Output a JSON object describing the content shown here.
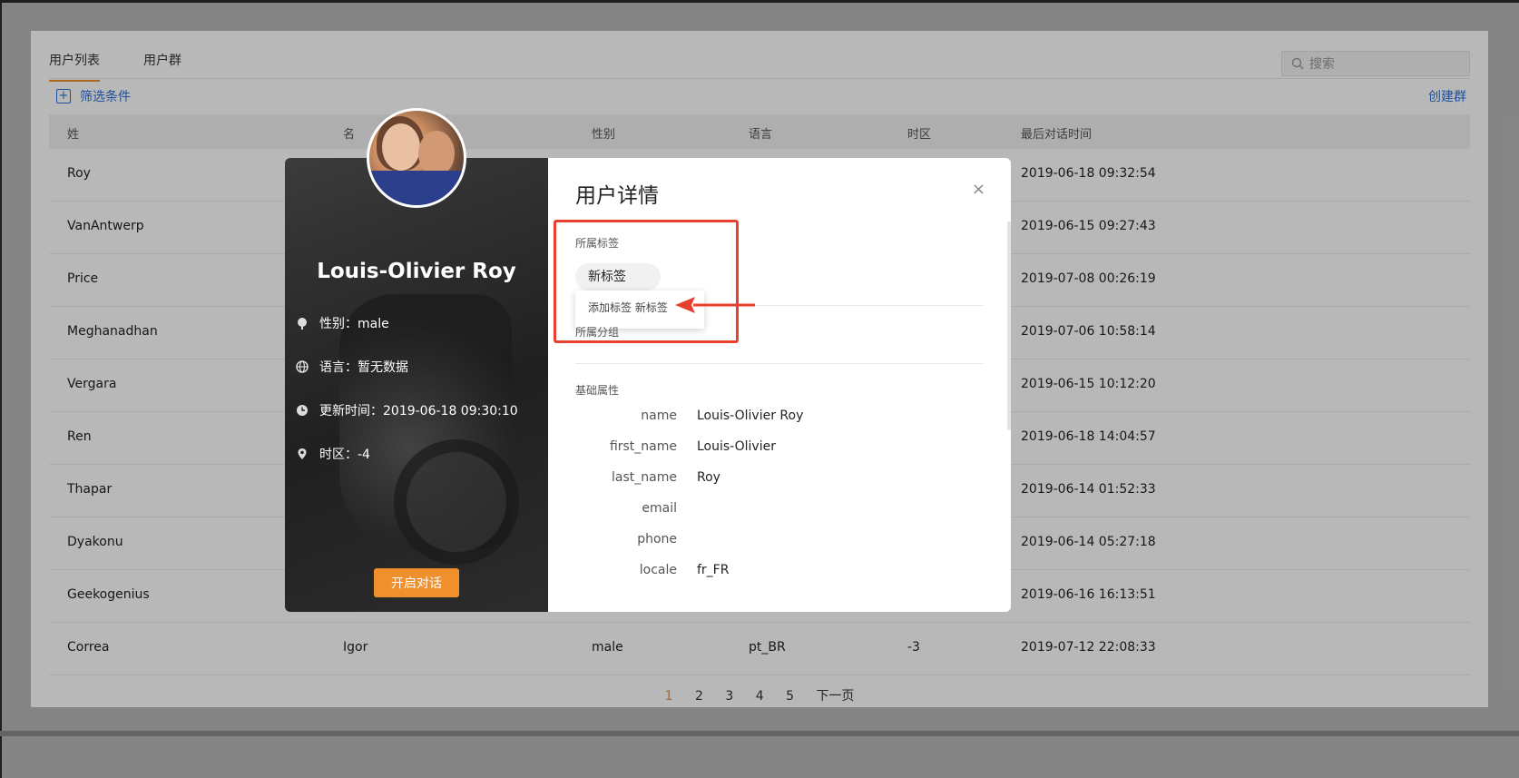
{
  "tabs": [
    {
      "label": "用户列表",
      "active": true
    },
    {
      "label": "用户群",
      "active": false
    }
  ],
  "search": {
    "placeholder": "搜索"
  },
  "filter_label": "筛选条件",
  "create_group_label": "创建群",
  "table": {
    "headers": [
      "姓",
      "名",
      "性别",
      "语言",
      "时区",
      "最后对话时间"
    ],
    "rows": [
      {
        "last": "Roy",
        "first": "",
        "gender": "",
        "lang": "",
        "tz": "",
        "time": "2019-06-18 09:32:54"
      },
      {
        "last": "VanAntwerp",
        "first": "",
        "gender": "",
        "lang": "",
        "tz": "",
        "time": "2019-06-15 09:27:43"
      },
      {
        "last": "Price",
        "first": "",
        "gender": "",
        "lang": "",
        "tz": "",
        "time": "2019-07-08 00:26:19"
      },
      {
        "last": "Meghanadhan",
        "first": "",
        "gender": "",
        "lang": "",
        "tz": "",
        "time": "2019-07-06 10:58:14"
      },
      {
        "last": "Vergara",
        "first": "",
        "gender": "",
        "lang": "",
        "tz": "",
        "time": "2019-06-15 10:12:20"
      },
      {
        "last": "Ren",
        "first": "",
        "gender": "",
        "lang": "",
        "tz": "",
        "time": "2019-06-18 14:04:57"
      },
      {
        "last": "Thapar",
        "first": "",
        "gender": "",
        "lang": "",
        "tz": "",
        "time": "2019-06-14 01:52:33"
      },
      {
        "last": "Dyakonu",
        "first": "",
        "gender": "",
        "lang": "",
        "tz": "",
        "time": "2019-06-14 05:27:18"
      },
      {
        "last": "Geekogenius",
        "first": "",
        "gender": "",
        "lang": "",
        "tz": "",
        "time": "2019-06-16 16:13:51"
      },
      {
        "last": "Correa",
        "first": "Igor",
        "gender": "male",
        "lang": "pt_BR",
        "tz": "-3",
        "time": "2019-07-12 22:08:33"
      }
    ]
  },
  "pagination": {
    "pages": [
      "1",
      "2",
      "3",
      "4",
      "5"
    ],
    "current": "1",
    "next_label": "下一页"
  },
  "modal": {
    "user_name": "Louis-Olivier Roy",
    "gender": "性别：male",
    "language": "语言：暂无数据",
    "updated": "更新时间：2019-06-18 09:30:10",
    "timezone": "时区：-4",
    "open_chat_label": "开启对话",
    "title": "用户详情",
    "close_symbol": "×",
    "tags_label": "所属标签",
    "tag_value": "新标签",
    "tag_dropdown_option": "添加标签 新标签",
    "group_label": "所属分组",
    "basic_label": "基础属性",
    "attributes": [
      {
        "key": "name",
        "value": "Louis-Olivier Roy"
      },
      {
        "key": "first_name",
        "value": "Louis-Olivier"
      },
      {
        "key": "last_name",
        "value": "Roy"
      },
      {
        "key": "email",
        "value": ""
      },
      {
        "key": "phone",
        "value": ""
      },
      {
        "key": "locale",
        "value": "fr_FR"
      }
    ]
  },
  "colors": {
    "accent": "#f0902c",
    "link": "#2f6fd6",
    "highlight": "#e8402e"
  }
}
